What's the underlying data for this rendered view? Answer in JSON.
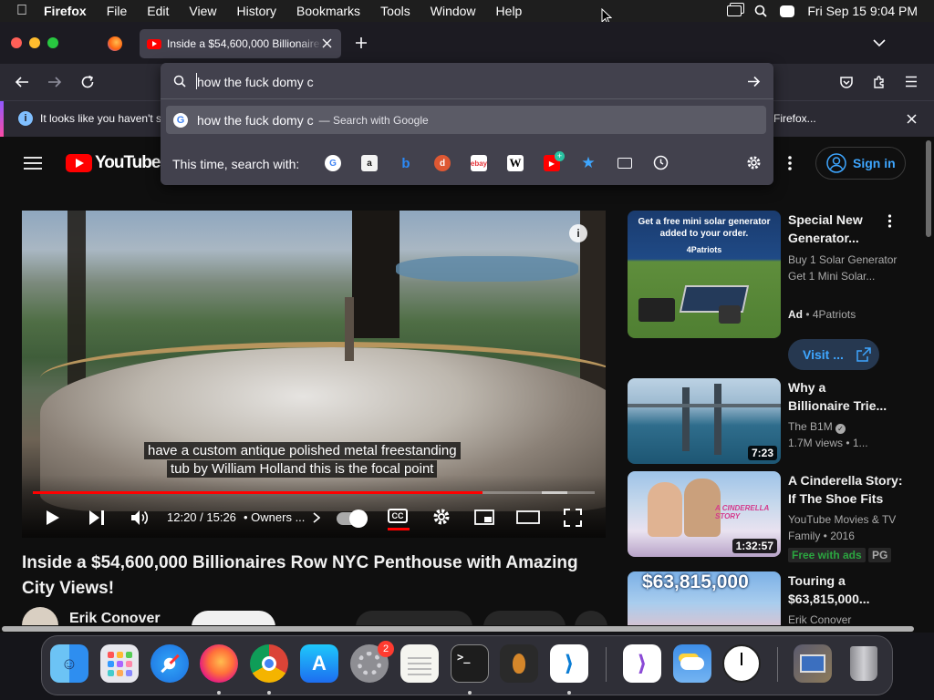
{
  "menubar": {
    "items": [
      "Firefox",
      "File",
      "Edit",
      "View",
      "History",
      "Bookmarks",
      "Tools",
      "Window",
      "Help"
    ],
    "datetime": "Fri Sep 15  9:04 PM"
  },
  "tabs": {
    "active_title": "Inside a $54,600,000 Billionaires Row NYC Penthouse with Amazing City Views!"
  },
  "urlbar": {
    "query": "how the fuck domy c",
    "suggestion_text": "how the fuck domy c",
    "suggestion_action": "— Search with Google",
    "engines_label": "This time, search with:"
  },
  "notification": {
    "text_left": "It looks like you haven't st",
    "text_right": "Firefox..."
  },
  "youtube": {
    "logo_text": "YouTube",
    "sign_in": "Sign in",
    "caption_line1": "have a custom antique polished metal freestanding",
    "caption_line2": "tub by William Holland this is the focal point",
    "time": "12:20 / 15:26",
    "chapter": "• Owners ...",
    "progress": 0.8,
    "video_title": "Inside a $54,600,000 Billionaires Row NYC Penthouse with Amazing City Views!",
    "channel": "Erik Conover",
    "ad": {
      "thumb_line1": "Get a free mini solar generator",
      "thumb_line2": "added to your order.",
      "thumb_brand": "4Patriots",
      "title": "Special New Generator...",
      "desc": "Buy 1 Solar Generator Get 1 Mini Solar...",
      "ad_label": "Ad",
      "advertiser": "• 4Patriots",
      "visit": "Visit ..."
    },
    "recommendations": [
      {
        "title": "Why a Billionaire Trie...",
        "channel": "The B1M",
        "meta": "1.7M views  • 1...",
        "duration": "7:23"
      },
      {
        "title": "A Cinderella Story: If The Shoe Fits",
        "channel": "YouTube Movies & TV",
        "meta": "Family • 2016",
        "badge": "Free with ads",
        "badge2": "PG",
        "duration": "1:32:57",
        "thumb_text": "A CINDERELLA STORY"
      },
      {
        "title": "Touring a $63,815,000...",
        "channel": "Erik Conover",
        "thumb_text": "$63,815,000"
      }
    ]
  },
  "dock": {
    "settings_badge": "2"
  }
}
